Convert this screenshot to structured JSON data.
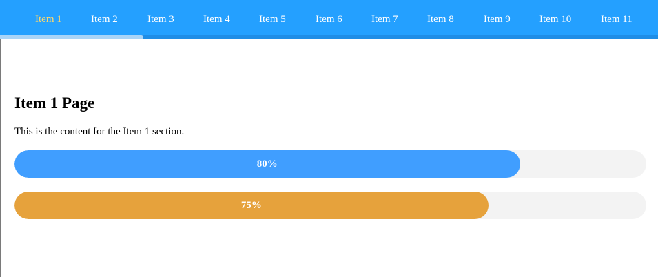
{
  "nav": {
    "items": [
      {
        "label": "Item 1",
        "active": true
      },
      {
        "label": "Item 2"
      },
      {
        "label": "Item 3"
      },
      {
        "label": "Item 4"
      },
      {
        "label": "Item 5"
      },
      {
        "label": "Item 6"
      },
      {
        "label": "Item 7"
      },
      {
        "label": "Item 8"
      },
      {
        "label": "Item 9"
      },
      {
        "label": "Item 10"
      },
      {
        "label": "Item 11"
      }
    ],
    "colors": {
      "bar": "#24a0ff",
      "active_text": "#ffd86b"
    }
  },
  "page": {
    "title": "Item 1 Page",
    "text": "This is the content for the Item 1 section."
  },
  "progress": [
    {
      "label": "80%",
      "value": 0.8,
      "color": "#409eff"
    },
    {
      "label": "75%",
      "value": 0.75,
      "color": "#e6a23c"
    }
  ]
}
